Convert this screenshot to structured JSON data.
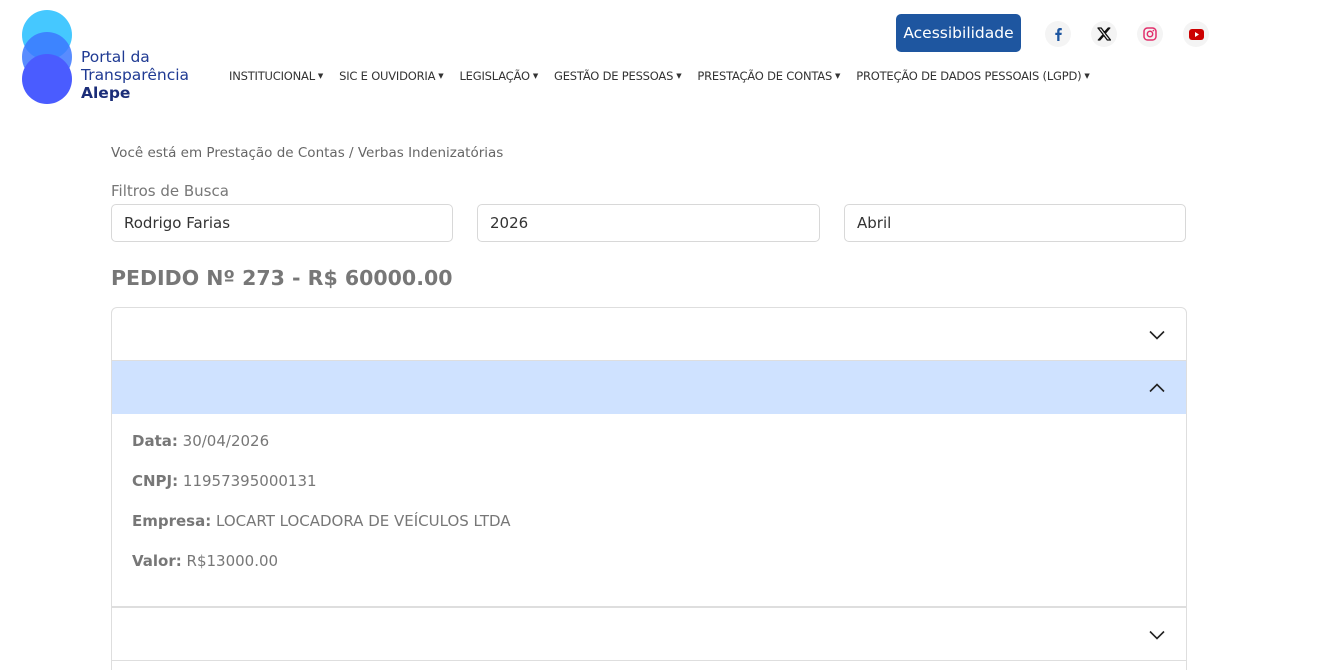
{
  "logo": {
    "line1": "Portal da",
    "line2": "Transparência",
    "line3": "Alepe"
  },
  "header": {
    "accessibility_label": "Acessibilidade",
    "social": [
      "facebook-icon",
      "x-icon",
      "instagram-icon",
      "youtube-icon"
    ],
    "colors": {
      "accent": "#1e56a0",
      "youtube": "#cc0000",
      "instagram": "#e1306c",
      "facebook": "#1e56a0"
    }
  },
  "nav": {
    "items": [
      {
        "label": "INSTITUCIONAL"
      },
      {
        "label": "SIC E OUVIDORIA"
      },
      {
        "label": "LEGISLAÇÃO"
      },
      {
        "label": "GESTÃO DE PESSOAS"
      },
      {
        "label": "PRESTAÇÃO DE CONTAS"
      },
      {
        "label": "PROTEÇÃO DE DADOS PESSOAIS (LGPD)"
      }
    ]
  },
  "breadcrumb": "Você está em Prestação de Contas / Verbas Indenizatórias",
  "filters": {
    "label": "Filtros de Busca",
    "name": "Rodrigo Farias",
    "year": "2026",
    "month": "Abril"
  },
  "order": {
    "title": "PEDIDO Nº 273 - R$ 60000.00"
  },
  "detail": {
    "date_label": "Data:",
    "date_value": "30/04/2026",
    "cnpj_label": "CNPJ:",
    "cnpj_value": "11957395000131",
    "company_label": "Empresa:",
    "company_value": "LOCART LOCADORA DE VEÍCULOS LTDA",
    "value_label": "Valor:",
    "value_value": "R$13000.00"
  },
  "accordion_colors": {
    "expanded_header": "#cfe2ff"
  }
}
